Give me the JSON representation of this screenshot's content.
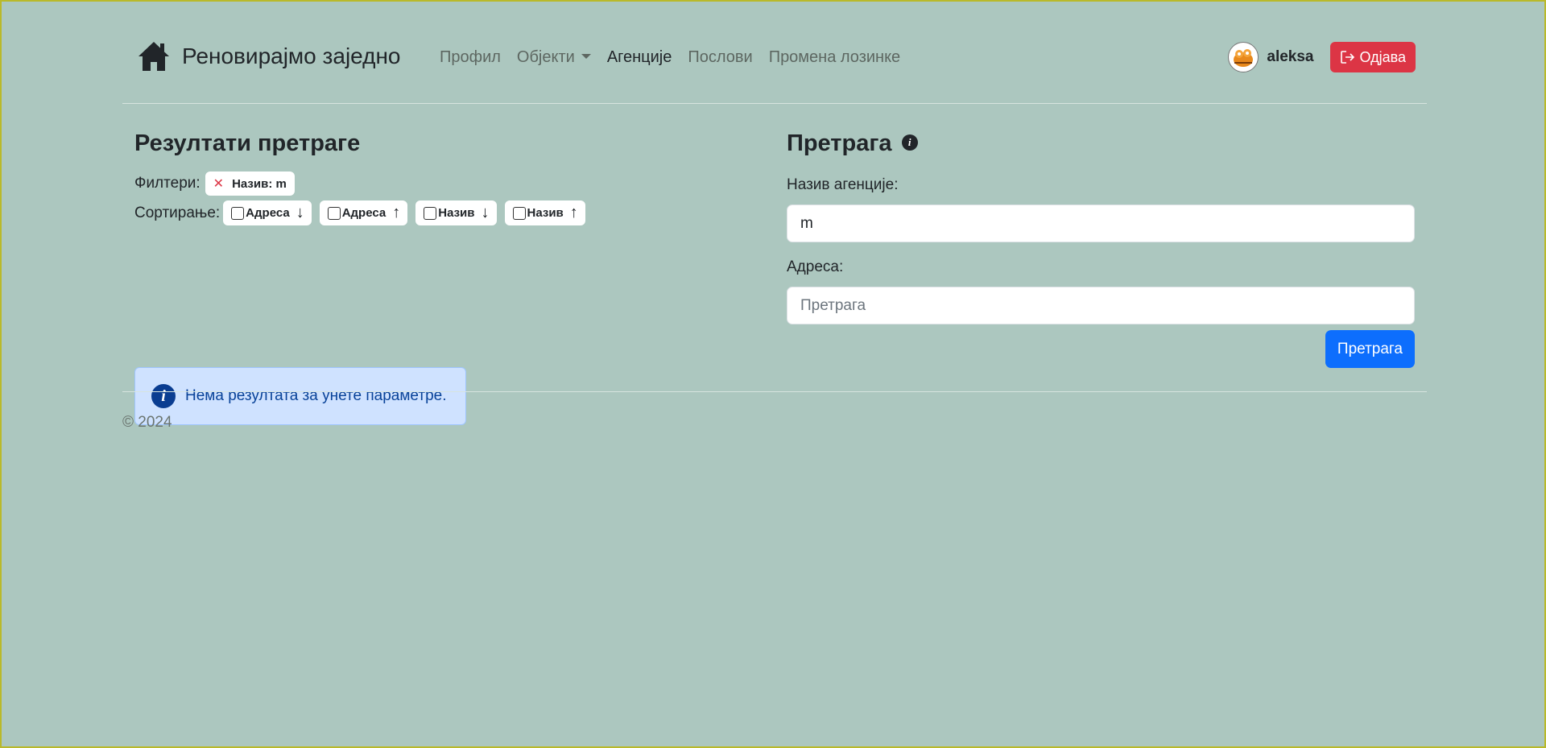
{
  "brand": {
    "title": "Реновирајмо заједно",
    "icon": "house-icon"
  },
  "nav": {
    "items": [
      {
        "label": "Профил"
      },
      {
        "label": "Објекти"
      },
      {
        "label": "Агенције"
      },
      {
        "label": "Послови"
      },
      {
        "label": "Промена лозинке"
      }
    ]
  },
  "user": {
    "name": "aleksa",
    "logout_label": "Одјава"
  },
  "results": {
    "title": "Резултати претраге",
    "filters_label": "Филтери:",
    "active_filter": "Назив: m",
    "sort_label": "Сортирање:",
    "sort_options": [
      {
        "label": "Адреса",
        "arrow": "↓"
      },
      {
        "label": "Адреса",
        "arrow": "↑"
      },
      {
        "label": "Назив",
        "arrow": "↓"
      },
      {
        "label": "Назив",
        "arrow": "↑"
      }
    ],
    "empty_message": "Нема резултата за унете параметре."
  },
  "search": {
    "title": "Претрага",
    "name_label": "Назив агенције:",
    "name_value": "m",
    "address_label": "Адреса:",
    "address_placeholder": "Претрага",
    "button_label": "Претрага"
  },
  "footer": {
    "copyright": "© 2024"
  },
  "colors": {
    "background": "#acc7bf",
    "primary": "#0d6efd",
    "danger": "#dc3545",
    "info_bg": "#cfe2ff"
  }
}
